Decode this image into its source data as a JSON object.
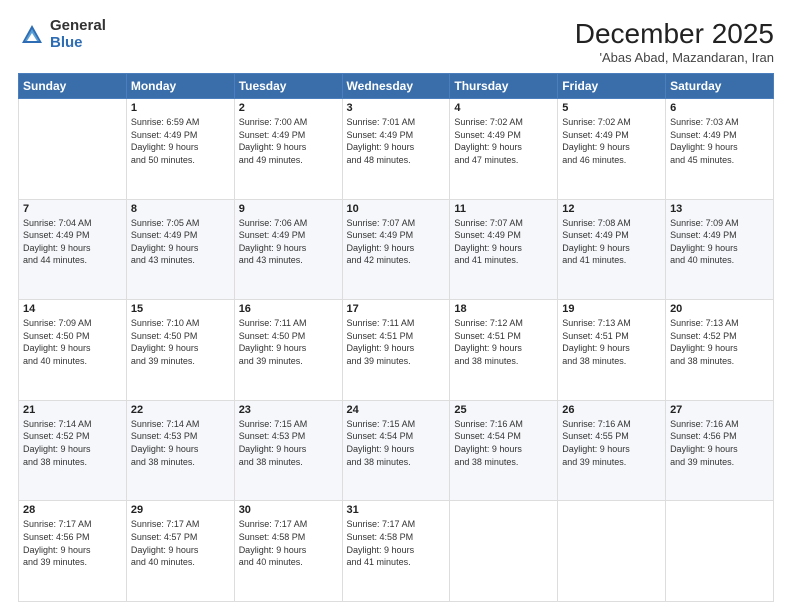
{
  "header": {
    "logo_general": "General",
    "logo_blue": "Blue",
    "month_title": "December 2025",
    "location": "'Abas Abad, Mazandaran, Iran"
  },
  "weekdays": [
    "Sunday",
    "Monday",
    "Tuesday",
    "Wednesday",
    "Thursday",
    "Friday",
    "Saturday"
  ],
  "weeks": [
    [
      {
        "day": "",
        "info": ""
      },
      {
        "day": "1",
        "info": "Sunrise: 6:59 AM\nSunset: 4:49 PM\nDaylight: 9 hours\nand 50 minutes."
      },
      {
        "day": "2",
        "info": "Sunrise: 7:00 AM\nSunset: 4:49 PM\nDaylight: 9 hours\nand 49 minutes."
      },
      {
        "day": "3",
        "info": "Sunrise: 7:01 AM\nSunset: 4:49 PM\nDaylight: 9 hours\nand 48 minutes."
      },
      {
        "day": "4",
        "info": "Sunrise: 7:02 AM\nSunset: 4:49 PM\nDaylight: 9 hours\nand 47 minutes."
      },
      {
        "day": "5",
        "info": "Sunrise: 7:02 AM\nSunset: 4:49 PM\nDaylight: 9 hours\nand 46 minutes."
      },
      {
        "day": "6",
        "info": "Sunrise: 7:03 AM\nSunset: 4:49 PM\nDaylight: 9 hours\nand 45 minutes."
      }
    ],
    [
      {
        "day": "7",
        "info": "Sunrise: 7:04 AM\nSunset: 4:49 PM\nDaylight: 9 hours\nand 44 minutes."
      },
      {
        "day": "8",
        "info": "Sunrise: 7:05 AM\nSunset: 4:49 PM\nDaylight: 9 hours\nand 43 minutes."
      },
      {
        "day": "9",
        "info": "Sunrise: 7:06 AM\nSunset: 4:49 PM\nDaylight: 9 hours\nand 43 minutes."
      },
      {
        "day": "10",
        "info": "Sunrise: 7:07 AM\nSunset: 4:49 PM\nDaylight: 9 hours\nand 42 minutes."
      },
      {
        "day": "11",
        "info": "Sunrise: 7:07 AM\nSunset: 4:49 PM\nDaylight: 9 hours\nand 41 minutes."
      },
      {
        "day": "12",
        "info": "Sunrise: 7:08 AM\nSunset: 4:49 PM\nDaylight: 9 hours\nand 41 minutes."
      },
      {
        "day": "13",
        "info": "Sunrise: 7:09 AM\nSunset: 4:49 PM\nDaylight: 9 hours\nand 40 minutes."
      }
    ],
    [
      {
        "day": "14",
        "info": "Sunrise: 7:09 AM\nSunset: 4:50 PM\nDaylight: 9 hours\nand 40 minutes."
      },
      {
        "day": "15",
        "info": "Sunrise: 7:10 AM\nSunset: 4:50 PM\nDaylight: 9 hours\nand 39 minutes."
      },
      {
        "day": "16",
        "info": "Sunrise: 7:11 AM\nSunset: 4:50 PM\nDaylight: 9 hours\nand 39 minutes."
      },
      {
        "day": "17",
        "info": "Sunrise: 7:11 AM\nSunset: 4:51 PM\nDaylight: 9 hours\nand 39 minutes."
      },
      {
        "day": "18",
        "info": "Sunrise: 7:12 AM\nSunset: 4:51 PM\nDaylight: 9 hours\nand 38 minutes."
      },
      {
        "day": "19",
        "info": "Sunrise: 7:13 AM\nSunset: 4:51 PM\nDaylight: 9 hours\nand 38 minutes."
      },
      {
        "day": "20",
        "info": "Sunrise: 7:13 AM\nSunset: 4:52 PM\nDaylight: 9 hours\nand 38 minutes."
      }
    ],
    [
      {
        "day": "21",
        "info": "Sunrise: 7:14 AM\nSunset: 4:52 PM\nDaylight: 9 hours\nand 38 minutes."
      },
      {
        "day": "22",
        "info": "Sunrise: 7:14 AM\nSunset: 4:53 PM\nDaylight: 9 hours\nand 38 minutes."
      },
      {
        "day": "23",
        "info": "Sunrise: 7:15 AM\nSunset: 4:53 PM\nDaylight: 9 hours\nand 38 minutes."
      },
      {
        "day": "24",
        "info": "Sunrise: 7:15 AM\nSunset: 4:54 PM\nDaylight: 9 hours\nand 38 minutes."
      },
      {
        "day": "25",
        "info": "Sunrise: 7:16 AM\nSunset: 4:54 PM\nDaylight: 9 hours\nand 38 minutes."
      },
      {
        "day": "26",
        "info": "Sunrise: 7:16 AM\nSunset: 4:55 PM\nDaylight: 9 hours\nand 39 minutes."
      },
      {
        "day": "27",
        "info": "Sunrise: 7:16 AM\nSunset: 4:56 PM\nDaylight: 9 hours\nand 39 minutes."
      }
    ],
    [
      {
        "day": "28",
        "info": "Sunrise: 7:17 AM\nSunset: 4:56 PM\nDaylight: 9 hours\nand 39 minutes."
      },
      {
        "day": "29",
        "info": "Sunrise: 7:17 AM\nSunset: 4:57 PM\nDaylight: 9 hours\nand 40 minutes."
      },
      {
        "day": "30",
        "info": "Sunrise: 7:17 AM\nSunset: 4:58 PM\nDaylight: 9 hours\nand 40 minutes."
      },
      {
        "day": "31",
        "info": "Sunrise: 7:17 AM\nSunset: 4:58 PM\nDaylight: 9 hours\nand 41 minutes."
      },
      {
        "day": "",
        "info": ""
      },
      {
        "day": "",
        "info": ""
      },
      {
        "day": "",
        "info": ""
      }
    ]
  ]
}
